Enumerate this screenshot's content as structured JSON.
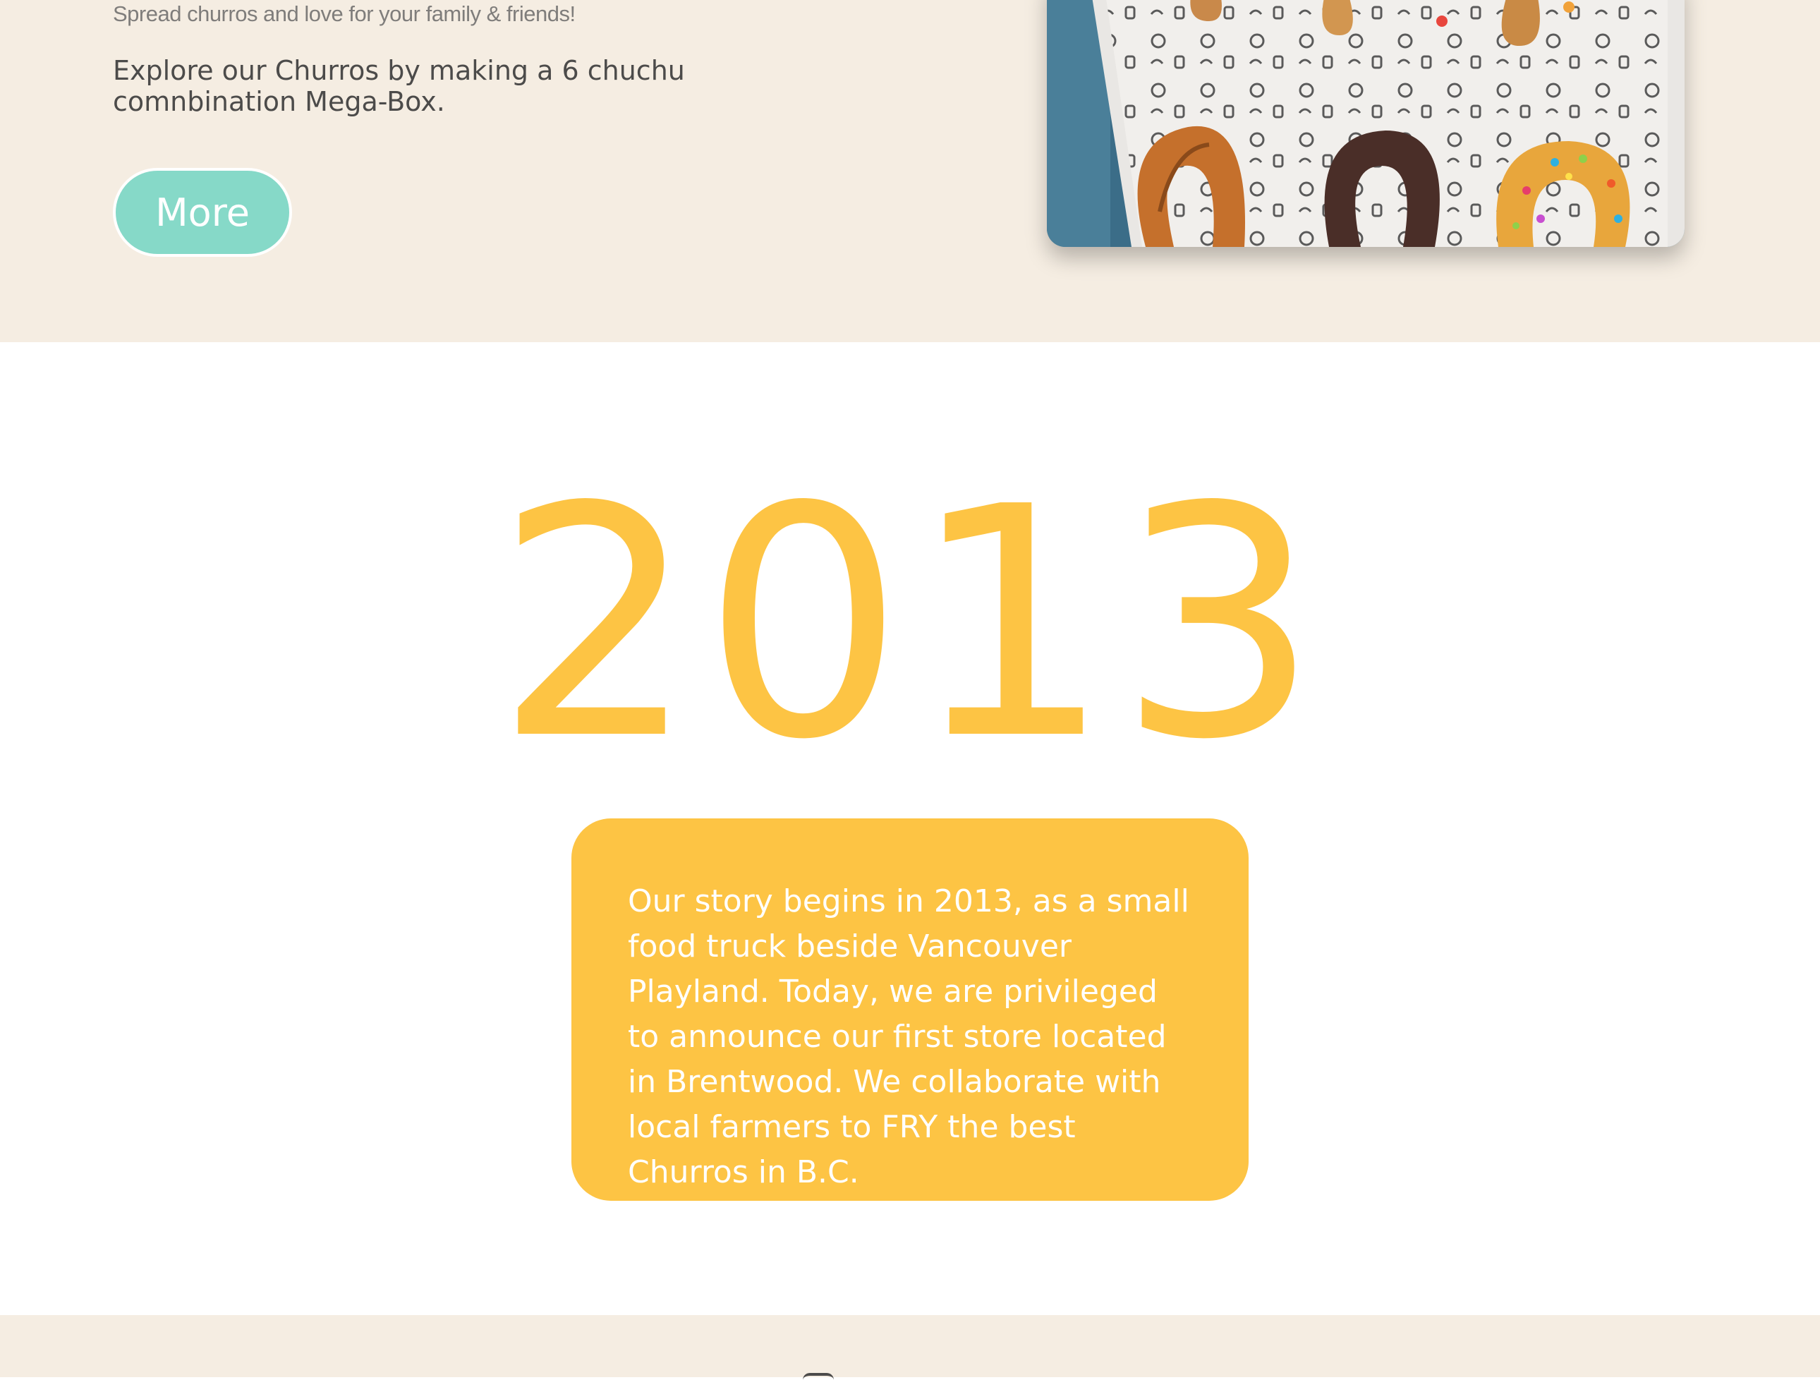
{
  "hero": {
    "tagline": "Spread churros and love for your family & friends!",
    "description": "Explore our Churros by making a 6 chuchu comnbination Mega-Box.",
    "more_button": "More",
    "photo_icon": "churros-box-photo"
  },
  "story": {
    "year": "2013",
    "text": "Our story begins in 2013, as a small food truck beside Vancouver Playland. Today, we are privileged to announce our first store located in Brentwood. We collaborate with local farmers to FRY the best Churros in B.C."
  },
  "colors": {
    "cream": "#f5ede2",
    "mint": "#86d9c8",
    "yellow": "#fdc444",
    "text_dark": "#4c4b4a",
    "text_muted": "#7f7d7b"
  }
}
